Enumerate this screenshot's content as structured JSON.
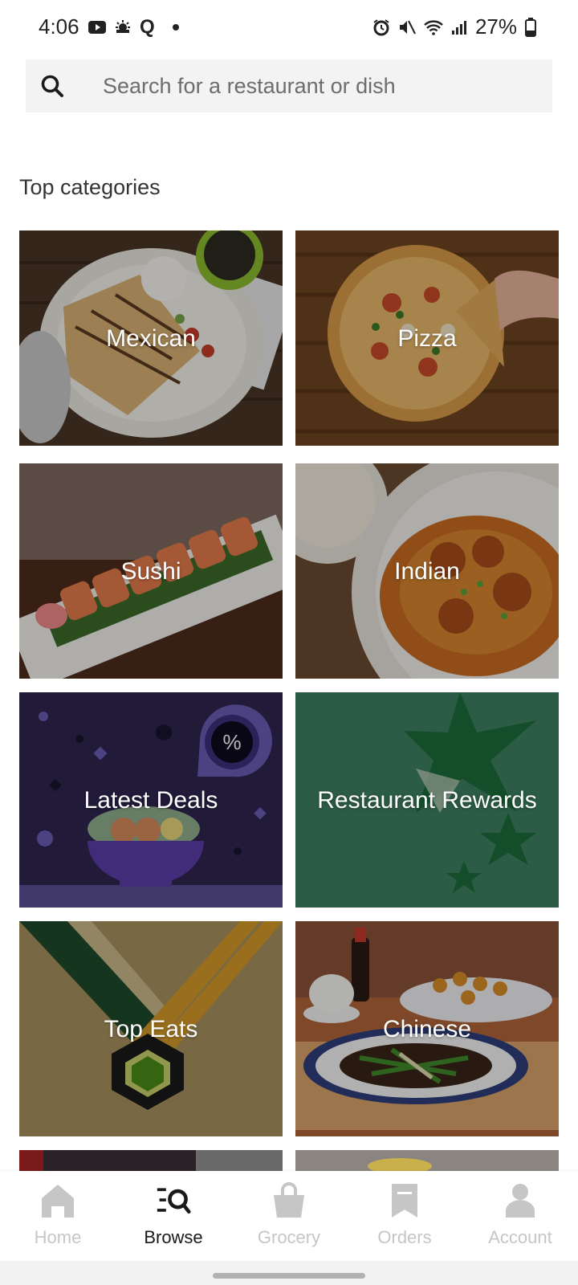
{
  "status_bar": {
    "time": "4:06",
    "left_icons": [
      "youtube-icon",
      "weather-icon",
      "q-icon",
      "dot-icon"
    ],
    "q_letter": "Q",
    "right_icons": [
      "alarm-icon",
      "mute-icon",
      "wifi-icon",
      "signal-icon",
      "battery-icon"
    ],
    "battery": "27%"
  },
  "search": {
    "placeholder": "Search for a restaurant or dish",
    "value": ""
  },
  "section_title": "Top categories",
  "categories": [
    {
      "label": "Mexican"
    },
    {
      "label": "Pizza"
    },
    {
      "label": "Sushi"
    },
    {
      "label": "Indian"
    },
    {
      "label": "Latest Deals"
    },
    {
      "label": "Restaurant Rewards"
    },
    {
      "label": "Top Eats"
    },
    {
      "label": "Chinese"
    }
  ],
  "bottom_nav": {
    "items": [
      {
        "label": "Home",
        "icon": "home-icon",
        "active": false
      },
      {
        "label": "Browse",
        "icon": "browse-icon",
        "active": true
      },
      {
        "label": "Grocery",
        "icon": "grocery-bag-icon",
        "active": false
      },
      {
        "label": "Orders",
        "icon": "receipt-icon",
        "active": false
      },
      {
        "label": "Account",
        "icon": "person-icon",
        "active": false
      }
    ]
  },
  "colors": {
    "deals_bg": "#2e2450",
    "rewards_bg": "#3d8060",
    "top_eats_bg": "#a8915f",
    "nav_inactive": "#c6c6c6",
    "nav_active": "#1a1a1a"
  }
}
